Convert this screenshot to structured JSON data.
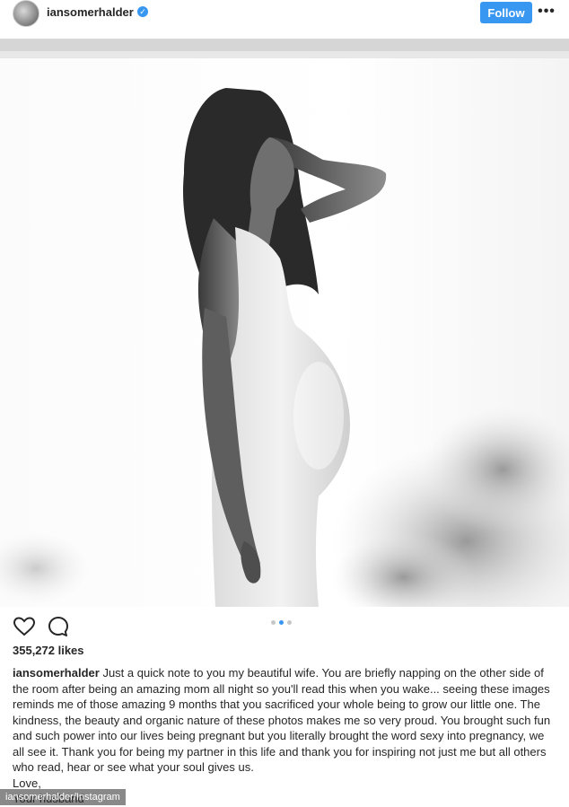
{
  "header": {
    "username": "iansomerhalder",
    "verified_glyph": "✓",
    "follow_label": "Follow",
    "more_label": "•••",
    "avatar_icon": "profile-avatar"
  },
  "post": {
    "image_alt": "Black and white photo of a pregnant woman standing in profile",
    "carousel": {
      "count": 3,
      "active": 1
    }
  },
  "actions": {
    "heart_icon": "heart-icon",
    "comment_icon": "comment-icon"
  },
  "likes": "355,272 likes",
  "caption": {
    "username": "iansomerhalder",
    "text": " Just a quick note to you my beautiful wife. You are briefly napping on the other side of the room after being an amazing mom all night so you'll read this when you wake... seeing these images reminds me of those amazing 9 months that you sacrificed your whole being to grow our little one. The kindness, the beauty and organic nature of these photos makes me so very proud. You brought such fun and such power into our lives being pregnant but you literally brought the word sexy into pregnancy, we all see it. Thank you for being my partner in this life and thank you for inspiring not just me but all others who read, hear or see what your soul gives us.",
    "line_love": "Love,",
    "line_sign": "Your husband"
  },
  "credit": "iansomerhalder/Instagram",
  "colors": {
    "accent": "#3897f0",
    "text": "#262626"
  }
}
